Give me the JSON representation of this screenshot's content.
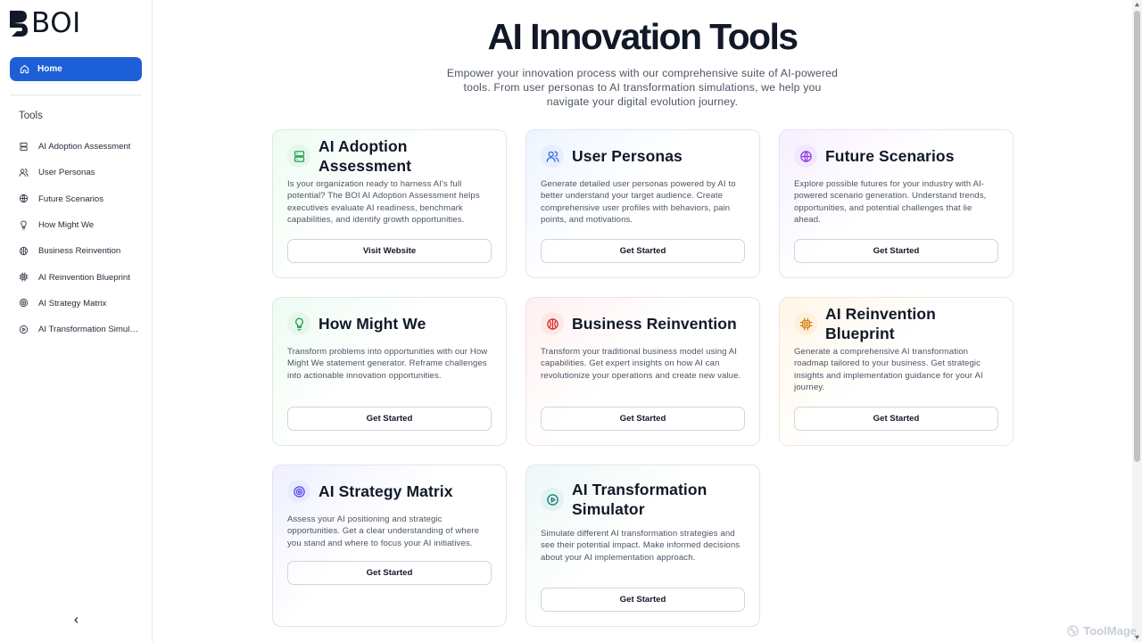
{
  "brand": {
    "name": "BOI"
  },
  "sidebar": {
    "home_label": "Home",
    "tools_heading": "Tools",
    "items": [
      {
        "label": "AI Adoption Assessment",
        "icon": "database-icon"
      },
      {
        "label": "User Personas",
        "icon": "users-icon"
      },
      {
        "label": "Future Scenarios",
        "icon": "globe-icon"
      },
      {
        "label": "How Might We",
        "icon": "lightbulb-icon"
      },
      {
        "label": "Business Reinvention",
        "icon": "globe-alt-icon"
      },
      {
        "label": "AI Reinvention Blueprint",
        "icon": "chip-icon"
      },
      {
        "label": "AI Strategy Matrix",
        "icon": "target-icon"
      },
      {
        "label": "AI Transformation Simulator",
        "icon": "play-circle-icon"
      }
    ]
  },
  "main": {
    "title": "AI Innovation Tools",
    "subtitle": "Empower your innovation process with our comprehensive suite of AI-powered tools. From user personas to AI transformation simulations, we help you navigate your digital evolution journey.",
    "cards": [
      {
        "title": "AI Adoption Assessment",
        "description": "Is your organization ready to harness AI's full potential? The BOI AI Adoption Assessment helps executives evaluate AI readiness, benchmark capabilities, and identify growth opportunities.",
        "button": "Visit Website",
        "icon": "database-icon",
        "accent": "#16a34a"
      },
      {
        "title": "User Personas",
        "description": "Generate detailed user personas powered by AI to better understand your target audience. Create comprehensive user profiles with behaviors, pain points, and motivations.",
        "button": "Get Started",
        "icon": "users-icon",
        "accent": "#2563eb"
      },
      {
        "title": "Future Scenarios",
        "description": "Explore possible futures for your industry with AI-powered scenario generation. Understand trends, opportunities, and potential challenges that lie ahead.",
        "button": "Get Started",
        "icon": "globe-icon",
        "accent": "#9333ea"
      },
      {
        "title": "How Might We",
        "description": "Transform problems into opportunities with our How Might We statement generator. Reframe challenges into actionable innovation opportunities.",
        "button": "Get Started",
        "icon": "lightbulb-icon",
        "accent": "#16a34a"
      },
      {
        "title": "Business Reinvention",
        "description": "Transform your traditional business model using AI capabilities. Get expert insights on how AI can revolutionize your operations and create new value.",
        "button": "Get Started",
        "icon": "globe-alt-icon",
        "accent": "#dc2626"
      },
      {
        "title": "AI Reinvention Blueprint",
        "description": "Generate a comprehensive AI transformation roadmap tailored to your business. Get strategic insights and implementation guidance for your AI journey.",
        "button": "Get Started",
        "icon": "chip-icon",
        "accent": "#d97706"
      },
      {
        "title": "AI Strategy Matrix",
        "description": "Assess your AI positioning and strategic opportunities. Get a clear understanding of where you stand and where to focus your AI initiatives.",
        "button": "Get Started",
        "icon": "target-icon",
        "accent": "#4f46e5"
      },
      {
        "title": "AI Transformation Simulator",
        "description": "Simulate different AI transformation strategies and see their potential impact. Make informed decisions about your AI implementation approach.",
        "button": "Get Started",
        "icon": "play-circle-icon",
        "accent": "#0f766e"
      }
    ]
  },
  "watermark": {
    "text": "ToolMage"
  }
}
